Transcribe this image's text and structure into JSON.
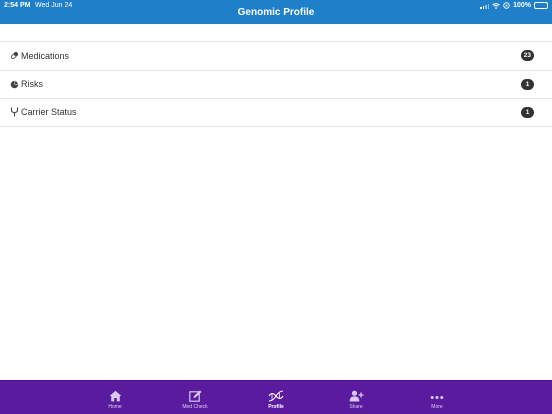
{
  "status_bar": {
    "time": "2:54 PM",
    "date": "Wed Jun 24",
    "battery_text": "100%"
  },
  "nav": {
    "title": "Genomic Profile"
  },
  "list": {
    "items": [
      {
        "icon": "pill-icon",
        "label": "Medications",
        "count": "23"
      },
      {
        "icon": "pie-chart-icon",
        "label": "Risks",
        "count": "1"
      },
      {
        "icon": "branch-icon",
        "label": "Carrier Status",
        "count": "1"
      }
    ]
  },
  "tabs": [
    {
      "icon": "home-icon",
      "label": "Home",
      "active": false
    },
    {
      "icon": "edit-icon",
      "label": "Med Check",
      "active": false
    },
    {
      "icon": "dna-icon",
      "label": "Profile",
      "active": true
    },
    {
      "icon": "add-user-icon",
      "label": "Share",
      "active": false
    },
    {
      "icon": "more-icon",
      "label": "More",
      "active": false
    }
  ],
  "colors": {
    "nav_bar": "#1f80c9",
    "tab_bar": "#5b1b9e",
    "badge": "#333333"
  }
}
